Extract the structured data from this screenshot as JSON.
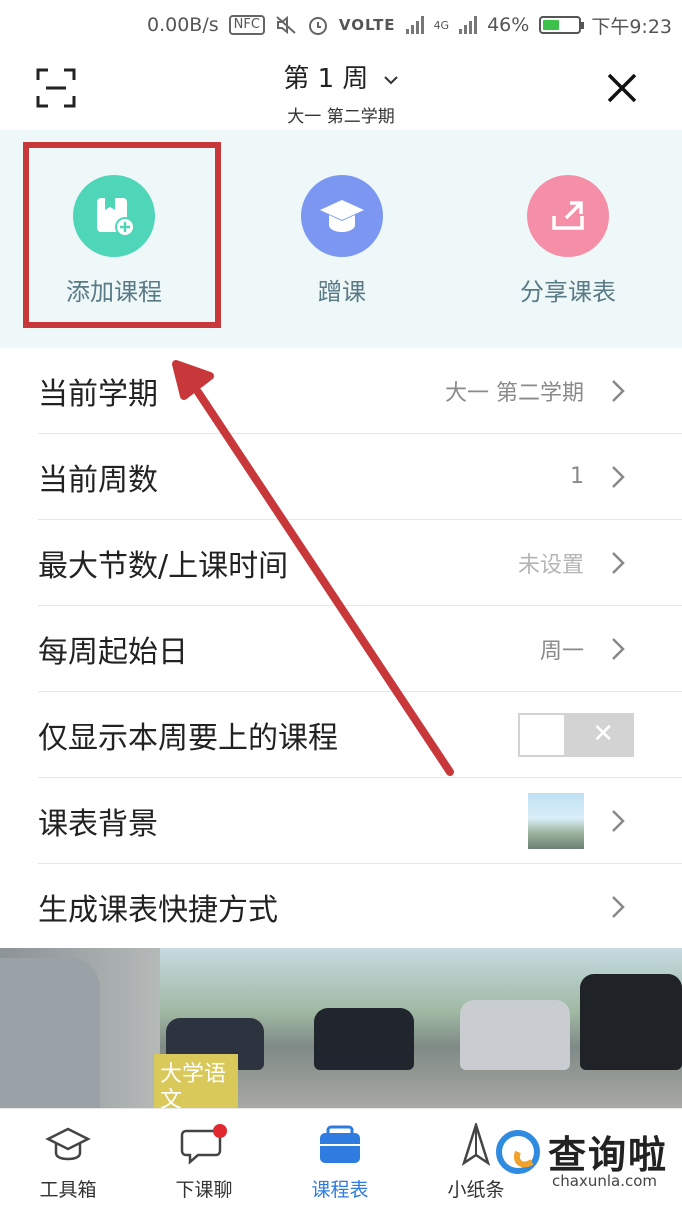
{
  "status_bar": {
    "net_speed": "0.00B/s",
    "nfc": "NFC",
    "volte": "VOLTE",
    "network": "4G",
    "battery": "46%",
    "battery_level": 0.46,
    "time": "下午9:23"
  },
  "header": {
    "title": "第 1 周",
    "subtitle": "大一  第二学期"
  },
  "quick_actions": [
    {
      "label": "添加课程",
      "icon": "add-course-icon",
      "color": "#4fd6b8"
    },
    {
      "label": "蹭课",
      "icon": "graduation-cap-icon",
      "color": "#7b97f1"
    },
    {
      "label": "分享课表",
      "icon": "share-icon",
      "color": "#f58fa8"
    }
  ],
  "settings": [
    {
      "label": "当前学期",
      "value": "大一  第二学期"
    },
    {
      "label": "当前周数",
      "value": "1"
    },
    {
      "label": "最大节数/上课时间",
      "value": "未设置"
    },
    {
      "label": "每周起始日",
      "value": "周一"
    },
    {
      "label": "仅显示本周要上的课程",
      "toggle": "off"
    },
    {
      "label": "课表背景",
      "thumbnail": "background-thumbnail"
    },
    {
      "label": "生成课表快捷方式"
    }
  ],
  "photo_tag": "大学语文",
  "tabs": [
    {
      "label": "工具箱",
      "icon": "toolbox-icon"
    },
    {
      "label": "下课聊",
      "icon": "chat-icon"
    },
    {
      "label": "课程表",
      "icon": "schedule-icon",
      "active": true
    },
    {
      "label": "小纸条",
      "icon": "paper-plane-icon"
    }
  ],
  "watermark": {
    "brand": "查询啦",
    "domain": "chaxunla.com"
  },
  "colors": {
    "accent": "#2f7ce0",
    "highlight": "#c8383a",
    "quick_bg": "#eef8f9"
  }
}
